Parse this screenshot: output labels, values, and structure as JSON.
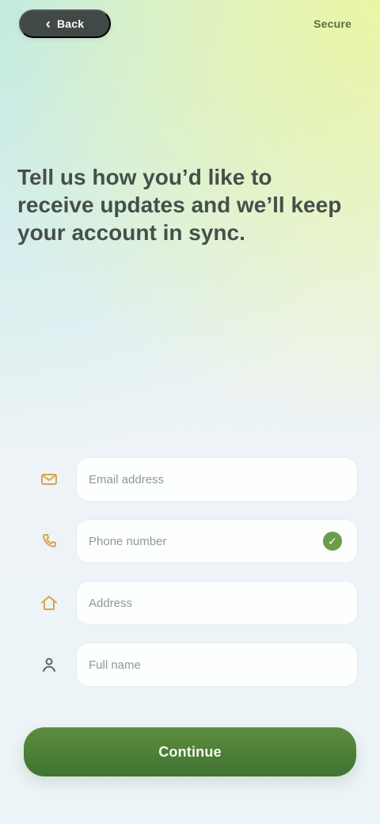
{
  "header": {
    "back_label": "Back",
    "status_text": "Secure"
  },
  "intro": {
    "text": "Tell us how you’d like to receive updates and we’ll keep your account in sync."
  },
  "fields": [
    {
      "icon": "mail-icon",
      "placeholder": "Email address"
    },
    {
      "icon": "phone-icon",
      "placeholder": "Phone number"
    },
    {
      "icon": "home-icon",
      "placeholder": "Address"
    },
    {
      "icon": "user-icon",
      "placeholder": "Full name"
    }
  ],
  "submit": {
    "label": "Continue"
  },
  "colors": {
    "accent": "#4f8237",
    "pill": "#414947",
    "text": "#45504b"
  }
}
